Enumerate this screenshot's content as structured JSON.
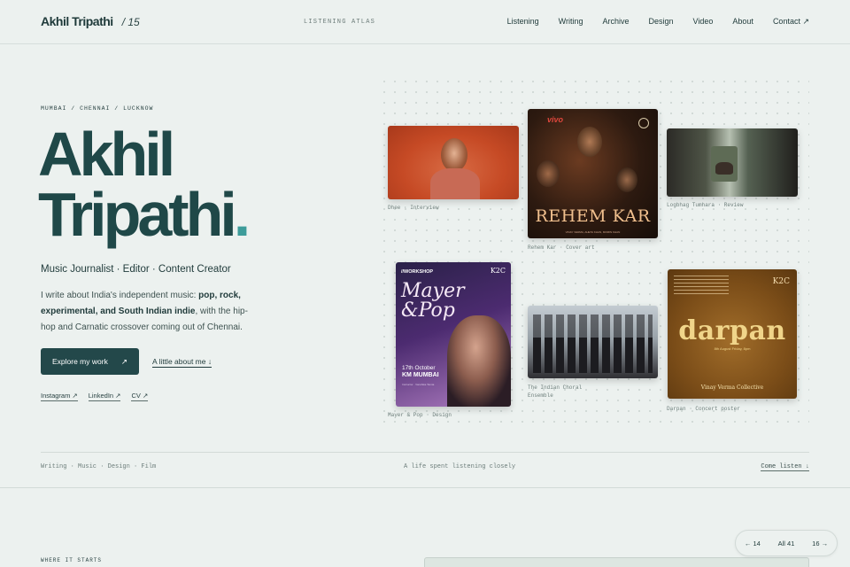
{
  "header": {
    "brand_name": "Akhil Tripathi",
    "brand_number": "/ 15",
    "center_label": "LISTENING ATLAS",
    "nav": [
      "Listening",
      "Writing",
      "Archive",
      "Design",
      "Video",
      "About",
      "Contact ↗"
    ]
  },
  "hero": {
    "locations": "MUMBAI / CHENNAI / LUCKNOW",
    "title_line1": "Akhil",
    "title_line2": "Tripathi",
    "title_dot": ".",
    "subtitle": "Music Journalist · Editor · Content Creator",
    "intro_start": "I write about India's independent music: ",
    "intro_bold": "pop, rock, experimental, and South Indian indie",
    "intro_end": ", with the hip-hop and Carnatic crossover coming out of Chennai.",
    "primary_button": "Explore my work",
    "primary_button_icon": "↗",
    "secondary_link": "A little about me ↓",
    "socials": [
      "Instagram ↗",
      "LinkedIn ↗",
      "CV ↗"
    ]
  },
  "cards": {
    "card1": {
      "caption": "Dhee · Interview"
    },
    "card2": {
      "caption": "Rehem Kar · Cover art",
      "title": "REHEM KAR",
      "logo": "vivo",
      "credits": "VINAY VERMA, AHETA KHAN, MOMIN KHAN"
    },
    "card3": {
      "caption": "Logbhag Tumhara · Review"
    },
    "card4": {
      "caption": "Mayer & Pop · Design",
      "label": "//WORKSHOP",
      "logo": "K2C",
      "title_line1": "Mayer",
      "title_line2": "&Pop",
      "date": "17th October",
      "venue": "KM MUMBAI",
      "instructor": "Instructor · Vanshika Tamta"
    },
    "card5": {
      "caption": "The Indian Choral Ensemble"
    },
    "card6": {
      "caption": "Darpan · Concert poster",
      "title": "darpan",
      "logo": "K2C",
      "date": "8th August Friday, 8pm",
      "footer": "Vinay Verma Collective"
    }
  },
  "footer_row": {
    "left": "Writing · Music · Design · Film",
    "center": "A life spent listening closely",
    "right": "Come listen ↓"
  },
  "next_section": {
    "label": "WHERE IT STARTS"
  },
  "pager": {
    "prev": "← 14",
    "all": "All 41",
    "next": "16 →"
  }
}
